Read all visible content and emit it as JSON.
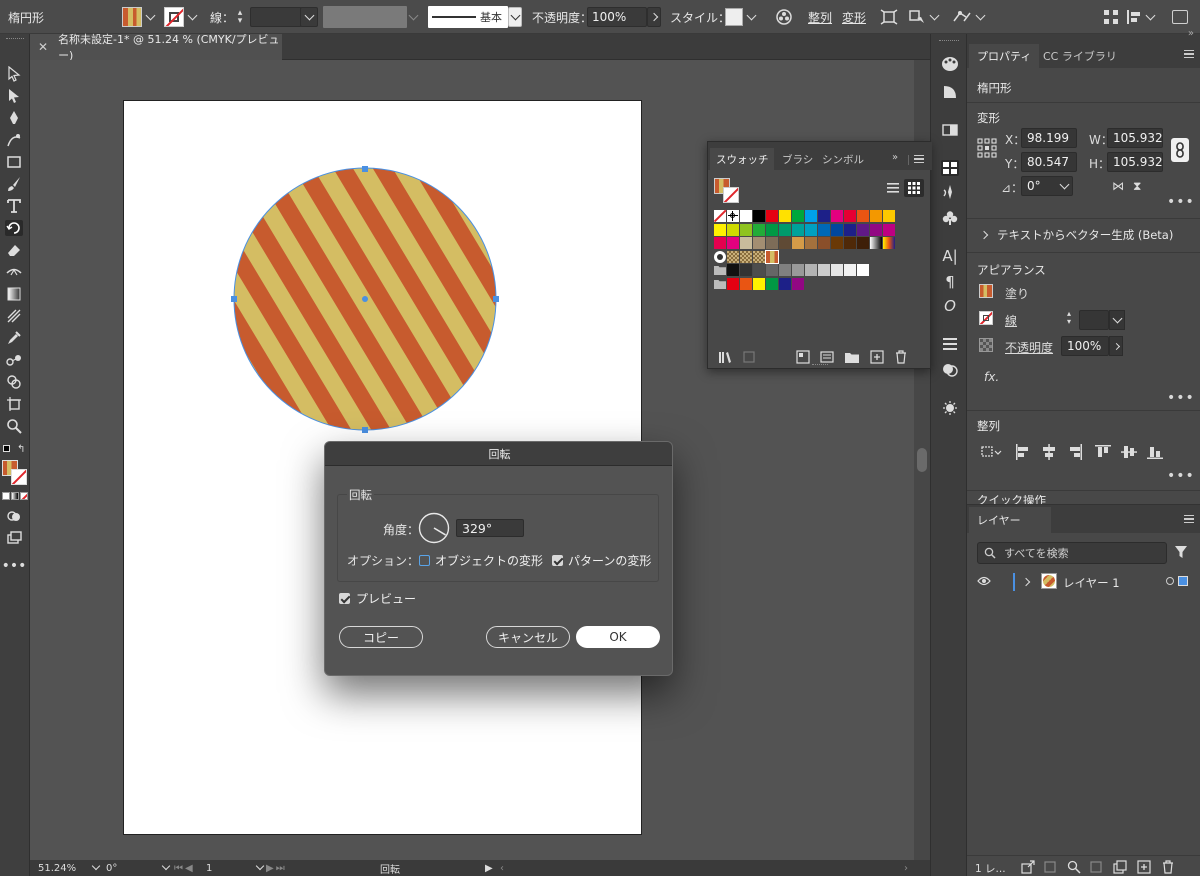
{
  "app": {
    "selection_type": "楕円形",
    "document_tab": "名称未設定-1* @ 51.24 % (CMYK/プレビュー)"
  },
  "control_bar": {
    "stroke_label": "線：",
    "stroke_style": "基本",
    "opacity_label": "不透明度：",
    "opacity_value": "100%",
    "style_label": "スタイル：",
    "align_label": "整列",
    "transform_label": "変形"
  },
  "status_bar": {
    "zoom": "51.24%",
    "rotation": "0°",
    "artboard": "1",
    "tool_name": "回転"
  },
  "swatches_panel": {
    "tabs": [
      "スウォッチ",
      "ブラシ",
      "シンボル"
    ],
    "rows": [
      [
        "none",
        "registration",
        "#ffffff",
        "#000000",
        "#e50012",
        "#ffe100",
        "#00a73c",
        "#00a0e9",
        "#1d2088",
        "#e4007f",
        "#e60033",
        "#e95513",
        "#f39800",
        "#fcc800"
      ],
      [
        "#fff100",
        "#cfdb00",
        "#8fc31f",
        "#22ac38",
        "#009944",
        "#009b6b",
        "#00a29a",
        "#00a0c1",
        "#0068b7",
        "#00479d",
        "#1d2088",
        "#601986",
        "#920783",
        "#be0081"
      ],
      [
        "#e5004f",
        "#e4007f",
        "#c9bc9c",
        "#a38e72",
        "#7d6c58",
        "#5f4a35",
        "#d49b48",
        "#a4713d",
        "#8a4f2a",
        "#6a3906",
        "#4f2908",
        "#3e1f08",
        "grad-bw",
        "grad-y"
      ],
      [
        "circle",
        "pattern-1",
        "pattern-2",
        "pattern-3",
        "pattern-stripe"
      ],
      [
        "folder",
        "#111111",
        "#333333",
        "#4d4d4d",
        "#666666",
        "#808080",
        "#999999",
        "#b3b3b3",
        "#cccccc",
        "#e6e6e6",
        "#f2f2f2",
        "#ffffff"
      ],
      [
        "folder",
        "#e50012",
        "#e95513",
        "#fff100",
        "#009944",
        "#1d2088",
        "#920783"
      ]
    ]
  },
  "rotate_dialog": {
    "title": "回転",
    "group_label": "回転",
    "angle_label": "角度：",
    "angle_value": "329°",
    "options_label": "オプション：",
    "option_object": "オブジェクトの変形",
    "option_object_checked": false,
    "option_pattern": "パターンの変形",
    "option_pattern_checked": true,
    "preview_label": "プレビュー",
    "preview_checked": true,
    "copy_button": "コピー",
    "cancel_button": "キャンセル",
    "ok_button": "OK"
  },
  "properties_panel": {
    "tabs": [
      "プロパティ",
      "CC ライブラリ"
    ],
    "object_type": "楕円形",
    "transform_title": "変形",
    "x_label": "X：",
    "x_value": "98.199",
    "y_label": "Y：",
    "y_value": "80.547",
    "w_label": "W：",
    "w_value": "105.932",
    "h_label": "H：",
    "h_value": "105.932",
    "angle_label": "⊿：",
    "angle_value": "0°",
    "text_to_vector": "テキストからベクター生成 (Beta)",
    "appearance_title": "アピアランス",
    "fill_label": "塗り",
    "stroke_label": "線",
    "opacity_label": "不透明度",
    "opacity_value": "100%",
    "fx_label": "fx.",
    "align_title": "整列",
    "quick_actions_title": "クイック操作"
  },
  "layers_panel": {
    "tab": "レイヤー",
    "search_placeholder": "すべてを検索",
    "layer_name": "レイヤー 1",
    "layer_count": "1 レ..."
  },
  "colors": {
    "stripe_orange": "#c75b2e",
    "stripe_yellow": "#d4bd63",
    "selection_blue": "#4a90e2"
  },
  "artwork": {
    "stripe_angle_deg": 329
  }
}
